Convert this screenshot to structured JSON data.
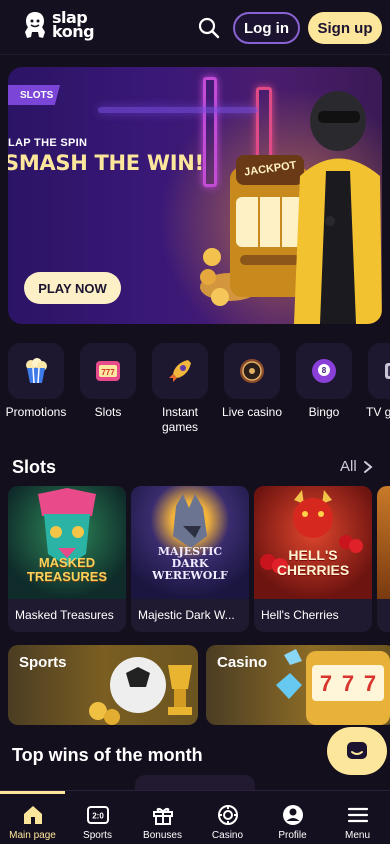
{
  "header": {
    "logo_line1": "slap",
    "logo_line2": "kong",
    "login_label": "Log in",
    "signup_label": "Sign up"
  },
  "hero": {
    "tag": "SLOTS",
    "line1": "LAP THE SPIN",
    "line2": "SMASH THE WIN!",
    "cta": "PLAY NOW",
    "machine_label": "JACKPOT"
  },
  "categories": [
    {
      "label": "Promotions",
      "icon": "popcorn-icon"
    },
    {
      "label": "Slots",
      "icon": "slot-777-icon"
    },
    {
      "label": "Instant\ngames",
      "icon": "rocket-icon"
    },
    {
      "label": "Live casino",
      "icon": "roulette-icon"
    },
    {
      "label": "Bingo",
      "icon": "bingo-ball-icon"
    },
    {
      "label": "TV g",
      "icon": "tv-icon"
    }
  ],
  "slots": {
    "title": "Slots",
    "all_label": "All",
    "games": [
      {
        "name": "Masked Treasures",
        "art_title": "MASKED\nTREASURES"
      },
      {
        "name": "Majestic Dark W...",
        "art_title": "MAJESTIC\nDARK\nWEREWOLF"
      },
      {
        "name": "Hell's Cherries",
        "art_title": "HELL'S\nCHERRIES"
      }
    ]
  },
  "banners": {
    "sports": "Sports",
    "casino": "Casino",
    "casino_reels": [
      "7",
      "7",
      "7"
    ]
  },
  "top_wins_title": "Top wins of the month",
  "nav": [
    {
      "label": "Main page",
      "icon": "home-icon",
      "active": true
    },
    {
      "label": "Sports",
      "icon": "scoreboard-icon",
      "score": "2:0"
    },
    {
      "label": "Bonuses",
      "icon": "gift-icon"
    },
    {
      "label": "Casino",
      "icon": "chip-icon"
    },
    {
      "label": "Profile",
      "icon": "profile-icon"
    },
    {
      "label": "Menu",
      "icon": "menu-icon"
    }
  ],
  "colors": {
    "background": "#140f1d",
    "accent_yellow": "#fce69c",
    "accent_purple": "#8a63d2"
  }
}
